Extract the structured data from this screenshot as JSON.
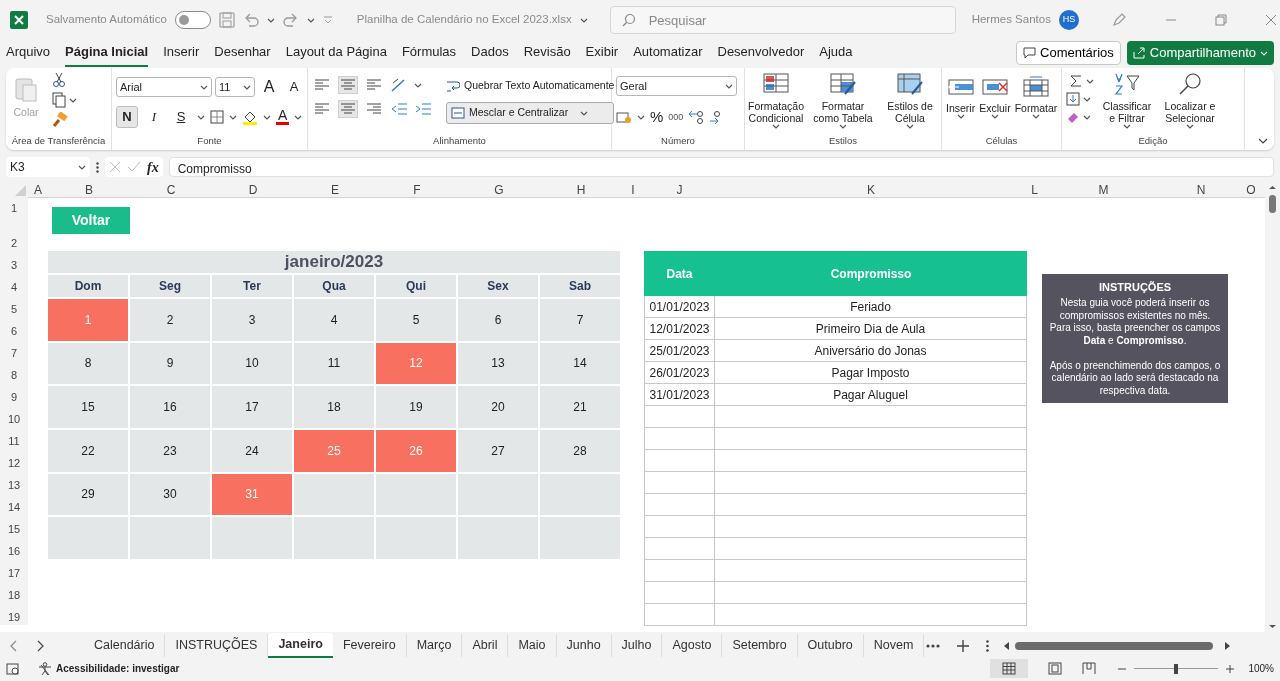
{
  "titlebar": {
    "autosave_label": "Salvamento Automático",
    "autosave_on": false,
    "filename": "Planilha de Calendário no Excel 2023.xlsx",
    "search_placeholder": "Pesquisar",
    "user_name": "Hermes Santos",
    "user_initials": "HS"
  },
  "menu_tabs": [
    {
      "label": "Arquivo",
      "selected": false
    },
    {
      "label": "Página Inicial",
      "selected": true
    },
    {
      "label": "Inserir",
      "selected": false
    },
    {
      "label": "Desenhar",
      "selected": false
    },
    {
      "label": "Layout da Página",
      "selected": false
    },
    {
      "label": "Fórmulas",
      "selected": false
    },
    {
      "label": "Dados",
      "selected": false
    },
    {
      "label": "Revisão",
      "selected": false
    },
    {
      "label": "Exibir",
      "selected": false
    },
    {
      "label": "Automatizar",
      "selected": false
    },
    {
      "label": "Desenvolvedor",
      "selected": false
    },
    {
      "label": "Ajuda",
      "selected": false
    }
  ],
  "comments_button": "Comentários",
  "share_button": "Compartilhamento",
  "ribbon": {
    "clipboard": {
      "paste": "Colar",
      "disabled": true,
      "label": "Área de Transferência"
    },
    "font": {
      "name": "Arial",
      "size": "11",
      "grow": "A",
      "shrink": "A",
      "bold": "N",
      "italic": "I",
      "underline": "S",
      "color_letter": "A",
      "label": "Fonte"
    },
    "alignment": {
      "wrap": "Quebrar Texto Automaticamente",
      "merge": "Mesclar e Centralizar",
      "label": "Alinhamento"
    },
    "number": {
      "format": "Geral",
      "percent": "%",
      "thousands": "000",
      "label": "Número"
    },
    "styles": {
      "buttons": [
        "Formatação Condicional",
        "Formatar como Tabela",
        "Estilos de Célula"
      ],
      "label": "Estilos"
    },
    "cells": {
      "buttons": [
        "Inserir",
        "Excluir",
        "Formatar"
      ],
      "label": "Células"
    },
    "editing": {
      "buttons": [
        "Classificar e Filtrar",
        "Localizar e Selecionar"
      ],
      "label": "Edição"
    }
  },
  "formula_bar": {
    "name_box": "K3",
    "fx": "fx",
    "formula": "Compromisso"
  },
  "columns": [
    "A",
    "B",
    "C",
    "D",
    "E",
    "F",
    "G",
    "H",
    "I",
    "J",
    "K",
    "L",
    "M",
    "N",
    "O"
  ],
  "rows": [
    "1",
    "2",
    "3",
    "4",
    "5",
    "6",
    "7",
    "8",
    "9",
    "10",
    "11",
    "12",
    "13",
    "14",
    "15",
    "16",
    "17",
    "18",
    "19"
  ],
  "sheet": {
    "back_button": "Voltar",
    "calendar": {
      "title": "janeiro/2023",
      "weekdays": [
        "Dom",
        "Seg",
        "Ter",
        "Qua",
        "Qui",
        "Sex",
        "Sab"
      ],
      "weeks": [
        [
          {
            "day": "1",
            "highlighted": true
          },
          {
            "day": "2",
            "highlighted": false
          },
          {
            "day": "3",
            "highlighted": false
          },
          {
            "day": "4",
            "highlighted": false
          },
          {
            "day": "5",
            "highlighted": false
          },
          {
            "day": "6",
            "highlighted": false
          },
          {
            "day": "7",
            "highlighted": false
          }
        ],
        [
          {
            "day": "8",
            "highlighted": false
          },
          {
            "day": "9",
            "highlighted": false
          },
          {
            "day": "10",
            "highlighted": false
          },
          {
            "day": "11",
            "highlighted": false
          },
          {
            "day": "12",
            "highlighted": true
          },
          {
            "day": "13",
            "highlighted": false
          },
          {
            "day": "14",
            "highlighted": false
          }
        ],
        [
          {
            "day": "15",
            "highlighted": false
          },
          {
            "day": "16",
            "highlighted": false
          },
          {
            "day": "17",
            "highlighted": false
          },
          {
            "day": "18",
            "highlighted": false
          },
          {
            "day": "19",
            "highlighted": false
          },
          {
            "day": "20",
            "highlighted": false
          },
          {
            "day": "21",
            "highlighted": false
          }
        ],
        [
          {
            "day": "22",
            "highlighted": false
          },
          {
            "day": "23",
            "highlighted": false
          },
          {
            "day": "24",
            "highlighted": false
          },
          {
            "day": "25",
            "highlighted": true
          },
          {
            "day": "26",
            "highlighted": true
          },
          {
            "day": "27",
            "highlighted": false
          },
          {
            "day": "28",
            "highlighted": false
          }
        ],
        [
          {
            "day": "29",
            "highlighted": false
          },
          {
            "day": "30",
            "highlighted": false
          },
          {
            "day": "31",
            "highlighted": true
          },
          {
            "highlighted": false
          },
          {
            "highlighted": false
          },
          {
            "highlighted": false
          },
          {
            "highlighted": false
          }
        ],
        [
          {
            "highlighted": false
          },
          {
            "highlighted": false
          },
          {
            "highlighted": false
          },
          {
            "highlighted": false
          },
          {
            "highlighted": false
          },
          {
            "highlighted": false
          },
          {
            "highlighted": false
          }
        ]
      ]
    },
    "appointments": {
      "columns": [
        "Data",
        "Compromisso"
      ],
      "rows": [
        {
          "date": "01/01/2023",
          "title": "Feriado"
        },
        {
          "date": "12/01/2023",
          "title": "Primeiro Dia de Aula"
        },
        {
          "date": "25/01/2023",
          "title": "Aniversário do Jonas"
        },
        {
          "date": "26/01/2023",
          "title": "Pagar Imposto"
        },
        {
          "date": "31/01/2023",
          "title": "Pagar Aluguel"
        }
      ]
    },
    "instructions": {
      "title": "INSTRUÇÕES",
      "paragraphs": [
        "Nesta guia você poderá inserir os compromissos existentes no mês. Para isso, basta preencher os campos **Data** e **Compromisso**.",
        "Após o preenchimendo dos campos, o calendário ao lado será destacado na respectiva data."
      ]
    }
  },
  "sheet_tabs": [
    {
      "label": "Calendário",
      "selected": false
    },
    {
      "label": "INSTRUÇÕES",
      "selected": false
    },
    {
      "label": "Janeiro",
      "selected": true
    },
    {
      "label": "Fevereiro",
      "selected": false
    },
    {
      "label": "Março",
      "selected": false
    },
    {
      "label": "Abril",
      "selected": false
    },
    {
      "label": "Maio",
      "selected": false
    },
    {
      "label": "Junho",
      "selected": false
    },
    {
      "label": "Julho",
      "selected": false
    },
    {
      "label": "Agosto",
      "selected": false
    },
    {
      "label": "Setembro",
      "selected": false
    },
    {
      "label": "Outubro",
      "selected": false
    },
    {
      "label": "Novem",
      "selected": false
    }
  ],
  "status_bar": {
    "accessibility": "Acessibilidade: investigar",
    "zoom": "100%",
    "zoom_slider": {
      "level": 0.5
    }
  }
}
